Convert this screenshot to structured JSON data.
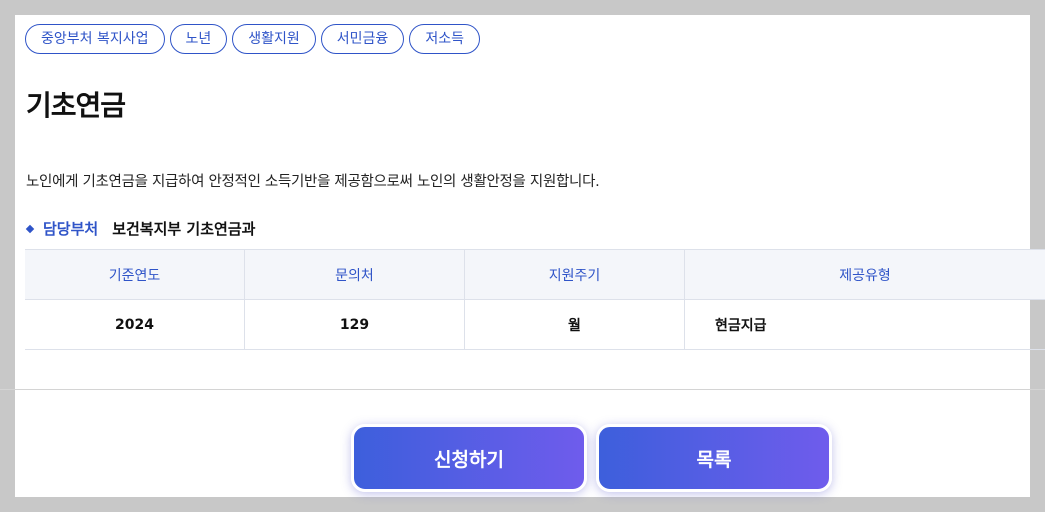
{
  "tags": [
    "중앙부처 복지사업",
    "노년",
    "생활지원",
    "서민금융",
    "저소득"
  ],
  "title": "기초연금",
  "description": "노인에게 기초연금을 지급하여 안정적인 소득기반을 제공함으로써 노인의 생활안정을 지원합니다.",
  "department": {
    "label": "담당부처",
    "value": "보건복지부 기초연금과"
  },
  "table": {
    "headers": [
      "기준연도",
      "문의처",
      "지원주기",
      "제공유형"
    ],
    "row": [
      "2024",
      "129",
      "월",
      "현금지급"
    ]
  },
  "buttons": {
    "apply": "신청하기",
    "list": "목록"
  },
  "colors": {
    "accent": "#2f54c8",
    "button_start": "#3d5fdc",
    "button_end": "#6f5cec"
  }
}
